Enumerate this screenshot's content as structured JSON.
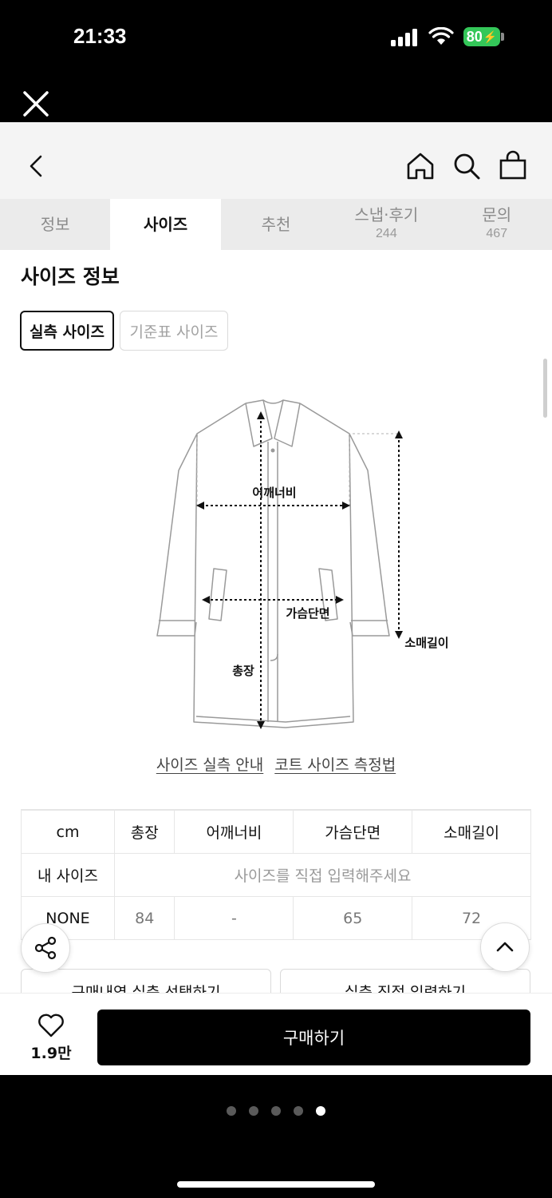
{
  "status": {
    "time": "21:33",
    "battery": "80"
  },
  "nav_tabs": [
    {
      "label": "정보",
      "count": ""
    },
    {
      "label": "사이즈",
      "count": ""
    },
    {
      "label": "추천",
      "count": ""
    },
    {
      "label": "스냅·후기",
      "count": "244"
    },
    {
      "label": "문의",
      "count": "467"
    }
  ],
  "active_tab": "사이즈",
  "section_title": "사이즈 정보",
  "size_toggle": {
    "actual": "실측 사이즈",
    "standard": "기준표 사이즈"
  },
  "diagram_labels": {
    "shoulder": "어깨너비",
    "chest": "가슴단면",
    "sleeve": "소매길이",
    "length": "총장"
  },
  "links": {
    "guide": "사이즈 실측 안내",
    "method": "코트 사이즈 측정법"
  },
  "size_table": {
    "headers": [
      "cm",
      "총장",
      "어깨너비",
      "가슴단면",
      "소매길이"
    ],
    "my_size_label": "내 사이즈",
    "my_size_placeholder": "사이즈를 직접 입력해주세요",
    "rows": [
      [
        "NONE",
        "84",
        "-",
        "65",
        "72"
      ]
    ]
  },
  "buttons": {
    "select_from_purchase": "구매내역 실측 선택하기",
    "direct_input": "실측 직접 입력하기",
    "buy": "구매하기"
  },
  "likes": "1.9만",
  "pagination": {
    "total": 5,
    "active": 5
  },
  "icons": [
    "close-icon",
    "back-icon",
    "home-icon",
    "search-icon",
    "shopping-bag-icon",
    "share-icon",
    "chevron-up-icon",
    "heart-icon"
  ],
  "colors": {
    "battery": "#34c759",
    "primary": "#000000"
  }
}
